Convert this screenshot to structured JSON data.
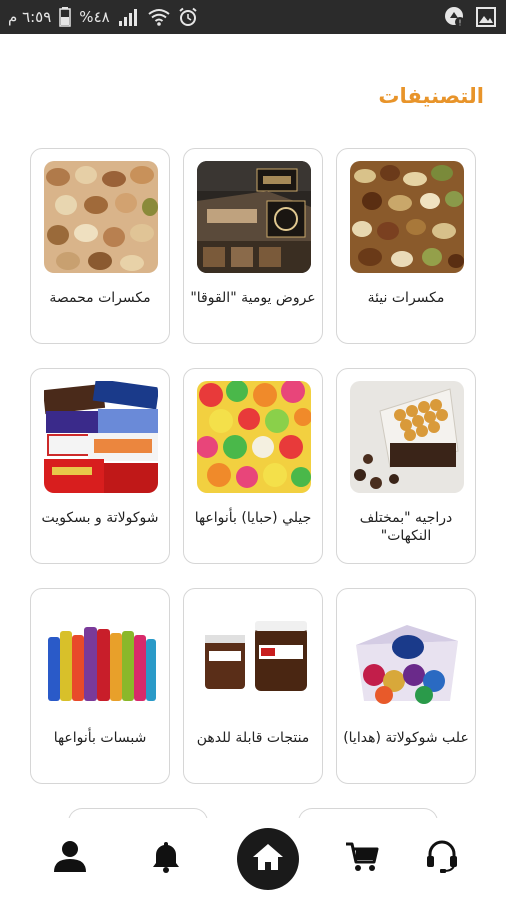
{
  "status_bar": {
    "time": "٦:٥٩ م",
    "battery": "%٤٨"
  },
  "page": {
    "title": "التصنيفات"
  },
  "categories": [
    {
      "label": "مكسرات نيئة",
      "image": "raw-nuts"
    },
    {
      "label": "عروض يومية \"القوقا\"",
      "image": "store-front"
    },
    {
      "label": "مكسرات محمصة",
      "image": "roasted-nuts"
    },
    {
      "label": "دراجيه \"بمختلف النكهات\"",
      "image": "dragee"
    },
    {
      "label": "جيلي (حبايا) بأنواعها",
      "image": "jelly-candy"
    },
    {
      "label": "شوكولاتة و بسكويت",
      "image": "chocolate-bars"
    },
    {
      "label": "علب شوكولاتة (هدايا)",
      "image": "gift-box"
    },
    {
      "label": "منتجات قابلة للدهن",
      "image": "spreads"
    },
    {
      "label": "شبسات بأنواعها",
      "image": "chips-cans"
    }
  ],
  "bottom_nav": {
    "items": [
      "support-icon",
      "cart-icon",
      "home-icon",
      "notifications-icon",
      "profile-icon"
    ]
  },
  "colors": {
    "title": "#e8942a",
    "status_bar": "#2b2b2b",
    "card_border": "#d6d6d6",
    "nav_home_bg": "#1a1a1a"
  }
}
